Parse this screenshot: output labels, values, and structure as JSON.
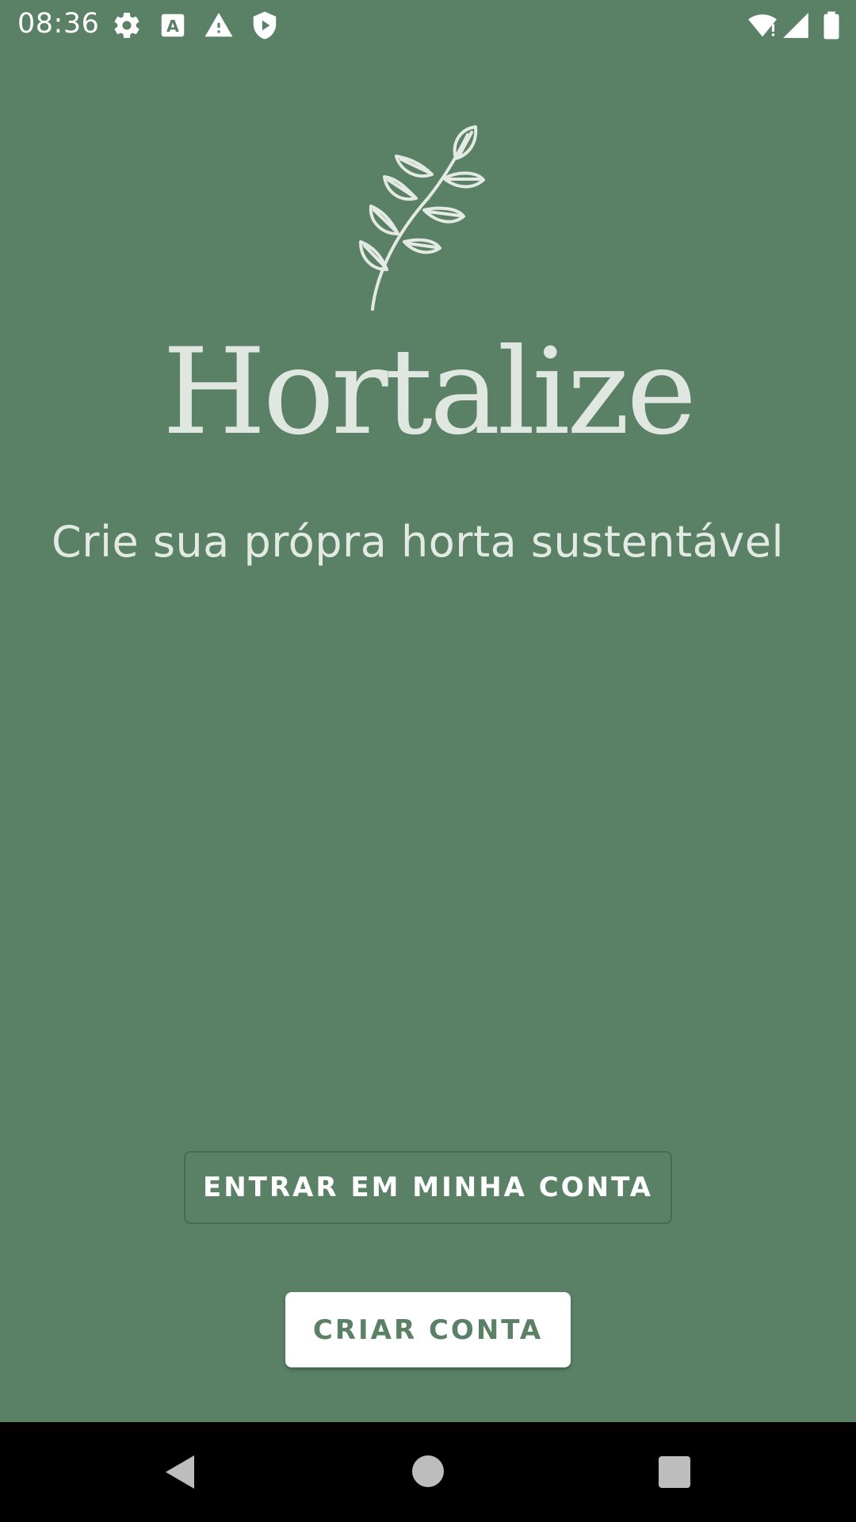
{
  "status_bar": {
    "time": "08:36",
    "icons": [
      "gear-icon",
      "text-a-icon",
      "warning-icon",
      "shield-icon",
      "wifi-icon",
      "signal-icon",
      "battery-icon"
    ]
  },
  "brand": {
    "logo_icon": "leaf-branch-icon",
    "title": "Hortalize",
    "tagline": "Crie sua própra horta sustentável"
  },
  "actions": {
    "login_label": "ENTRAR EM MINHA CONTA",
    "signup_label": "CRIAR CONTA"
  },
  "colors": {
    "background": "#5a8066",
    "button_primary_bg": "#ffffff",
    "button_primary_text": "#5a8066",
    "text_light": "#dfe7e0"
  },
  "nav_bar": {
    "icons": [
      "back-icon",
      "home-icon",
      "recents-icon"
    ]
  }
}
